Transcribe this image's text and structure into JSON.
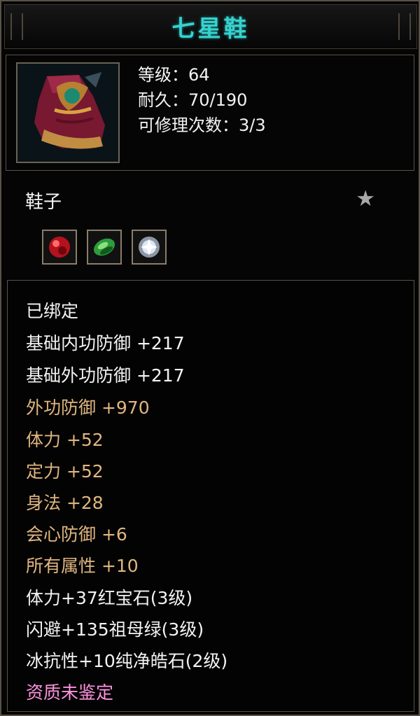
{
  "item": {
    "name": "七星鞋",
    "level": "等级：64",
    "durability": "耐久：70/190",
    "repairs": "可修理次数：3/3",
    "category": "鞋子",
    "bound": "已绑定",
    "attributes": [
      {
        "text": "基础内功防御  +217",
        "color": "white"
      },
      {
        "text": "基础外功防御  +217",
        "color": "white"
      },
      {
        "text": "外功防御  +970",
        "color": "gold"
      },
      {
        "text": "体力  +52",
        "color": "gold"
      },
      {
        "text": "定力  +52",
        "color": "gold"
      },
      {
        "text": "身法  +28",
        "color": "gold"
      },
      {
        "text": "会心防御  +6",
        "color": "gold"
      },
      {
        "text": "所有属性  +10",
        "color": "gold"
      },
      {
        "text": "体力+37红宝石(3级)",
        "color": "white"
      },
      {
        "text": "闪避+135祖母绿(3级)",
        "color": "white"
      },
      {
        "text": "冰抗性+10纯净皓石(2级)",
        "color": "white"
      },
      {
        "text": "资质未鉴定",
        "color": "pink"
      }
    ],
    "icons": [
      "boot-icon",
      "favorite-star-icon",
      "ruby-gem-icon",
      "emerald-gem-icon",
      "diamond-gem-icon"
    ],
    "colors": {
      "title": "#37d2cf",
      "white": "#f3f3f3",
      "gold": "#e0b67f",
      "pink": "#ff93df"
    }
  }
}
